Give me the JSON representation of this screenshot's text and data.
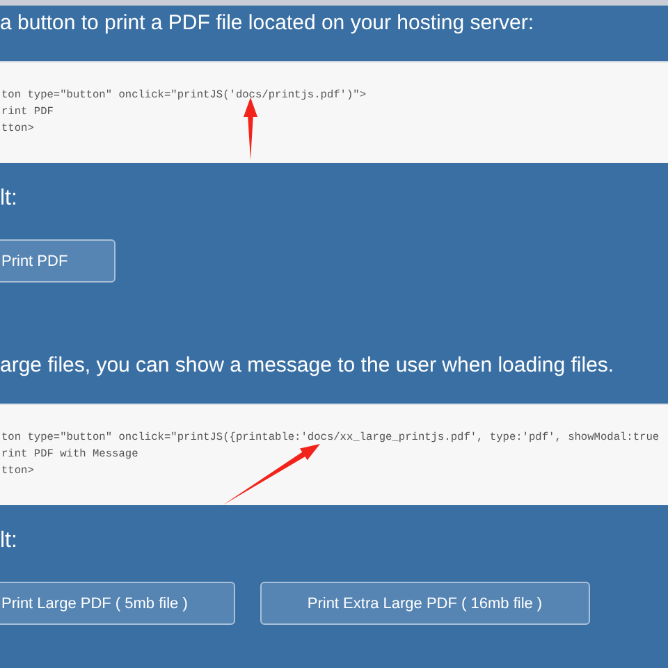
{
  "sections": [
    {
      "heading": "a button to print a PDF file located on your hosting server:",
      "code_lines": [
        "ton type=\"button\" onclick=\"printJS('docs/printjs.pdf')\">",
        "rint PDF",
        "tton>"
      ],
      "result_label": "lt:",
      "buttons": [
        "Print PDF"
      ]
    },
    {
      "heading": "arge files, you can show a message to the user when loading files.",
      "code_lines": [
        "ton type=\"button\" onclick=\"printJS({printable:'docs/xx_large_printjs.pdf', type:'pdf', showModal:true",
        "rint PDF with Message",
        "tton>"
      ],
      "result_label": "lt:",
      "buttons": [
        "Print Large PDF ( 5mb file )",
        "Print Extra Large PDF ( 16mb file )"
      ]
    }
  ]
}
